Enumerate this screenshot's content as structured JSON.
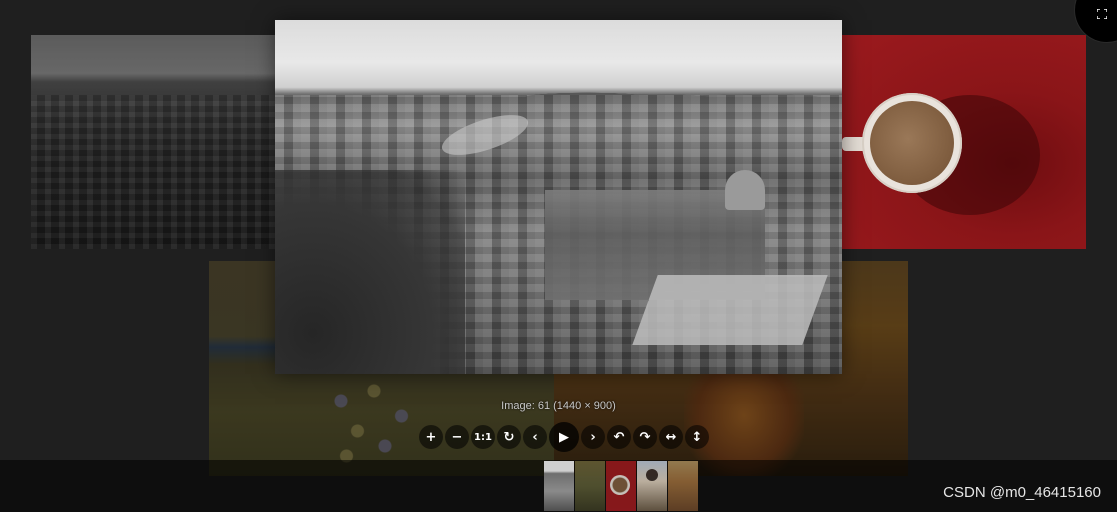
{
  "viewer": {
    "caption": "Image: 61 (1440 × 900)"
  },
  "toolbar": {
    "zoom_in": "+",
    "zoom_out": "−",
    "one_to_one": "1:1",
    "reset": "↻",
    "prev": "‹",
    "play": "▶",
    "next": "›",
    "rotate_left": "↶",
    "rotate_right": "↷",
    "flip_horizontal": "↔",
    "flip_vertical": "↕"
  },
  "icons": {
    "fullscreen": "fullscreen-icon"
  },
  "thumbnails": [
    {
      "name": "thumb-city"
    },
    {
      "name": "thumb-field"
    },
    {
      "name": "thumb-coffee"
    },
    {
      "name": "thumb-girl"
    },
    {
      "name": "thumb-sunset"
    }
  ],
  "watermark": "CSDN @m0_46415160"
}
